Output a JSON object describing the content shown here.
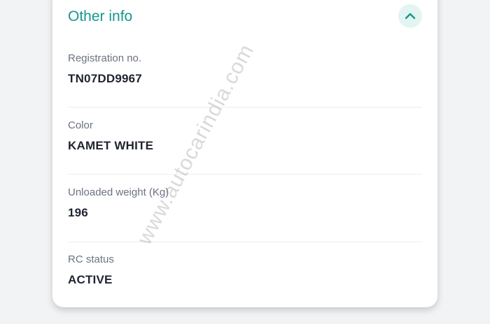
{
  "section": {
    "title": "Other info",
    "collapse_icon": "chevron-up-icon",
    "accent_color": "#15978f"
  },
  "rows": [
    {
      "label": "Registration no.",
      "value": "TN07DD9967"
    },
    {
      "label": "Color",
      "value": "KAMET WHITE"
    },
    {
      "label": "Unloaded weight (Kg)",
      "value": "196"
    },
    {
      "label": "RC status",
      "value": "ACTIVE"
    }
  ],
  "watermark": "www.autocarindia.com"
}
